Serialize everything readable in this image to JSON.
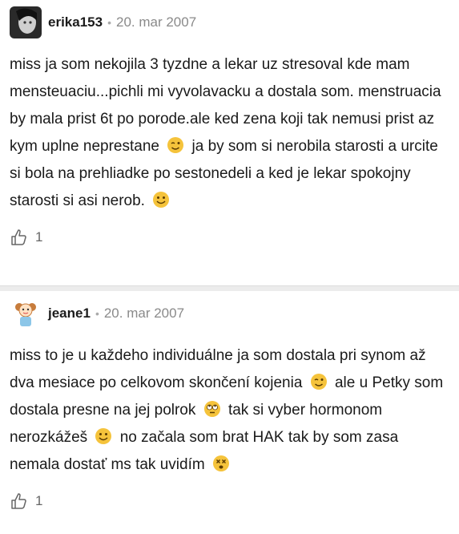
{
  "comments": [
    {
      "username": "erika153",
      "date": "20. mar 2007",
      "text_parts": [
        "miss ja som nekojila 3 tyzdne a lekar uz stresoval kde mam mensteuaciu...pichli mi vyvolavacku a dostala som. menstruacia by mala prist 6t po porode.ale ked zena koji tak nemusi prist az kym uplne neprestane",
        "ja by som si nerobila starosti a urcite si bola na prehliadke po sestonedeli a ked je lekar spokojny starosti si asi nerob."
      ],
      "emojis": [
        "wink-emoji",
        "smile-emoji"
      ],
      "likes": "1"
    },
    {
      "username": "jeane1",
      "date": "20. mar 2007",
      "text_parts": [
        "miss to je u každeho individuálne ja som dostala pri synom až dva mesiace po celkovom skončení kojenia",
        "ale u Petky som dostala presne na jej polrok",
        "tak si vyber hormonom nerozkážeš",
        "no začala som brat HAK tak by som zasa nemala dostať ms tak uvidím"
      ],
      "emojis": [
        "wink-emoji",
        "eye-roll-emoji",
        "smile-emoji",
        "dizzy-emoji"
      ],
      "likes": "1"
    }
  ],
  "separator": "•",
  "colors": {
    "emoji": "#f5c33b",
    "divider": "#ececec"
  }
}
